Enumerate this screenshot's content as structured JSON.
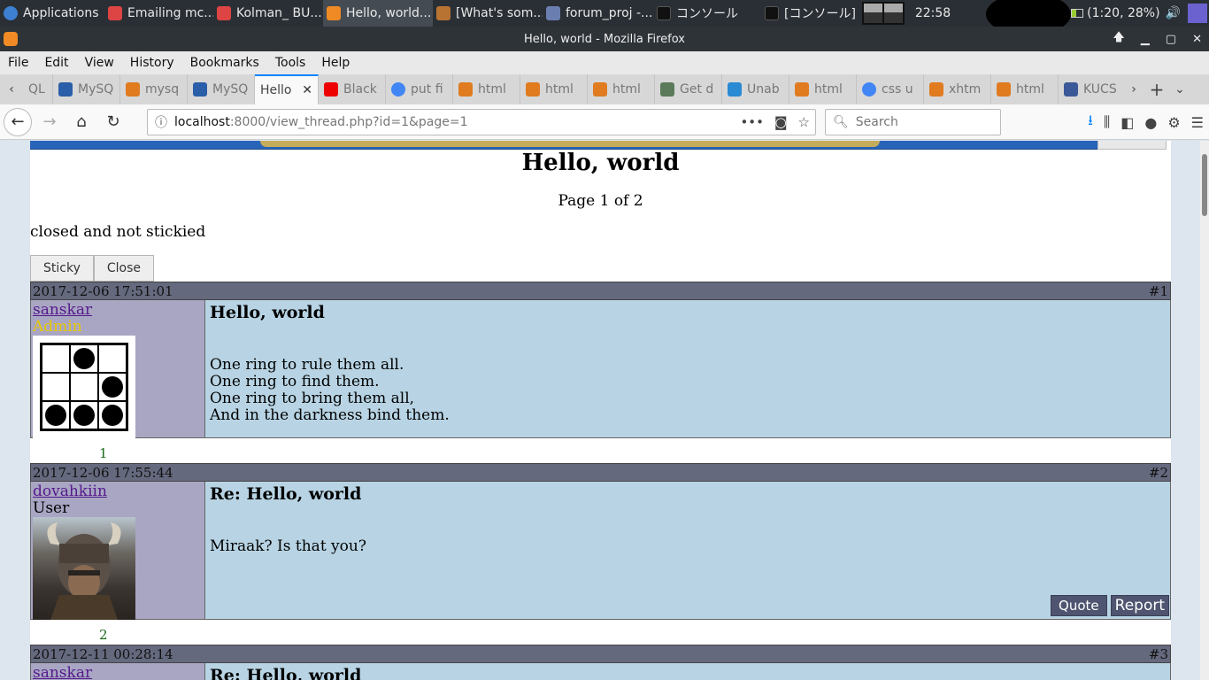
{
  "os_panel": {
    "tasks": [
      {
        "label": "Applications",
        "color": "#3d7fd1"
      },
      {
        "label": "Emailing mc...",
        "color": "#d44"
      },
      {
        "label": "Kolman_ BU...",
        "color": "#d44"
      },
      {
        "label": "Hello, world...",
        "color": "#f08a24",
        "active": true
      },
      {
        "label": "[What's som...",
        "color": "#b87333"
      },
      {
        "label": "forum_proj -...",
        "color": "#6a7fb0"
      },
      {
        "label": "コンソール",
        "color": "#222"
      },
      {
        "label": "[コンソール]",
        "color": "#222"
      }
    ],
    "clock": "22:58",
    "battery": "(1:20, 28%)"
  },
  "window": {
    "title": "Hello, world - Mozilla Firefox"
  },
  "menu": [
    "File",
    "Edit",
    "View",
    "History",
    "Bookmarks",
    "Tools",
    "Help"
  ],
  "tabs": [
    {
      "label": "QL",
      "color": "#888"
    },
    {
      "label": "MySQ",
      "color": "#2a5ea8"
    },
    {
      "label": "mysq",
      "color": "#e07b20"
    },
    {
      "label": "MySQ",
      "color": "#2a5ea8"
    },
    {
      "label": "Hello",
      "color": "#f08a24",
      "active": true
    },
    {
      "label": "Black",
      "color": "#e00"
    },
    {
      "label": "put fi",
      "color": "#4285f4"
    },
    {
      "label": "html",
      "color": "#e07b20"
    },
    {
      "label": "html",
      "color": "#e07b20"
    },
    {
      "label": "html",
      "color": "#e07b20"
    },
    {
      "label": "Get d",
      "color": "#5a7a5a"
    },
    {
      "label": "Unab",
      "color": "#2a8ad4"
    },
    {
      "label": "html",
      "color": "#e07b20"
    },
    {
      "label": "css u",
      "color": "#4285f4"
    },
    {
      "label": "xhtm",
      "color": "#e07b20"
    },
    {
      "label": "html",
      "color": "#e07b20"
    },
    {
      "label": "KUCS",
      "color": "#3b5998"
    }
  ],
  "nav": {
    "url_host": "localhost",
    "url_path": ":8000/view_thread.php?id=1&page=1",
    "search_placeholder": "Search"
  },
  "page": {
    "title": "Hello, world",
    "page_info": "Page 1 of 2",
    "state": "closed and not stickied",
    "sticky_label": "Sticky",
    "close_label": "Close"
  },
  "posts": [
    {
      "timestamp": "2017-12-06 17:51:01",
      "number": "#1",
      "username": "sanskar",
      "role": "Admin",
      "title": "Hello, world",
      "body": "One ring to rule them all.\nOne ring to find them.\nOne ring to bring them all,\nAnd in the darkness bind them.",
      "footer_num": "1"
    },
    {
      "timestamp": "2017-12-06 17:55:44",
      "number": "#2",
      "username": "dovahkiin",
      "role": "User",
      "title": "Re: Hello, world",
      "body": "Miraak? Is that you?",
      "quote_label": "Quote",
      "report_label": "Report",
      "footer_num": "2"
    },
    {
      "timestamp": "2017-12-11 00:28:14",
      "number": "#3",
      "username": "sanskar",
      "title": "Re: Hello, world"
    }
  ]
}
